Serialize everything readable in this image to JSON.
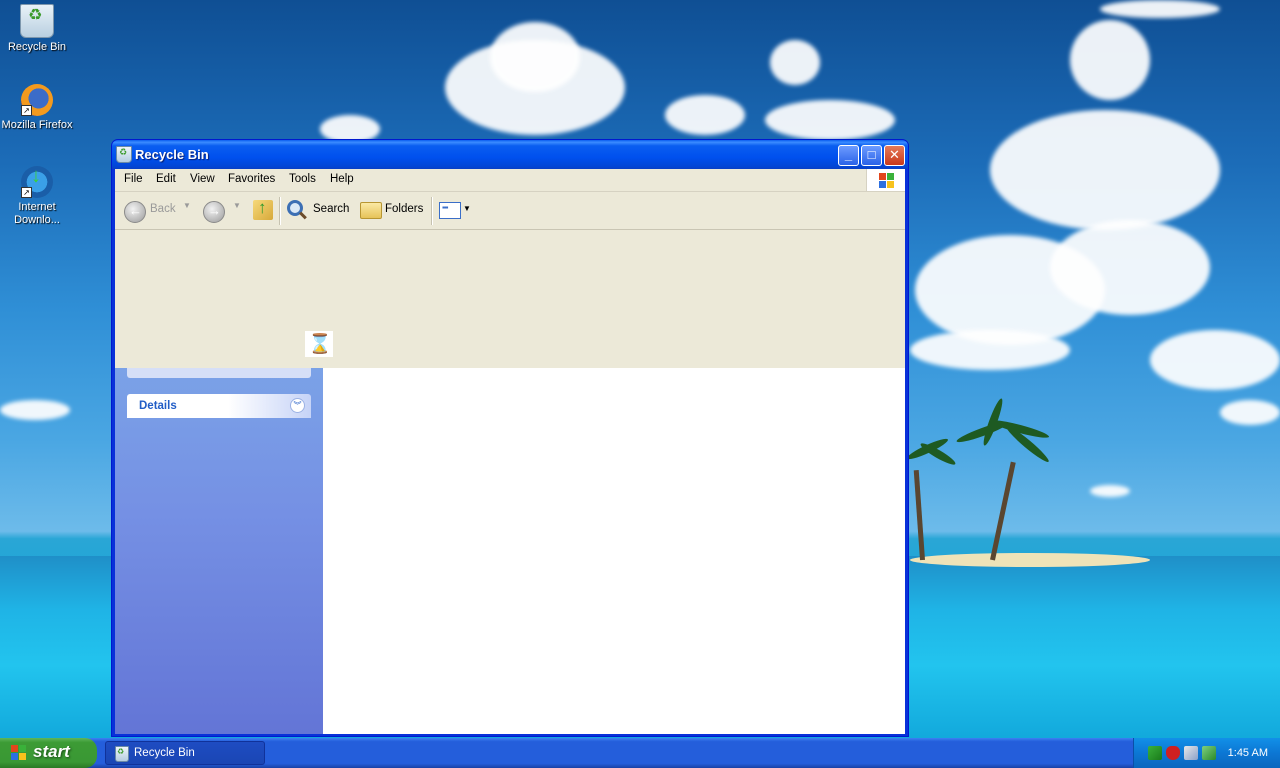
{
  "desktop": {
    "icons": [
      {
        "label": "Recycle Bin",
        "icon": "recycle-bin-icon"
      },
      {
        "label": "Mozilla Firefox",
        "icon": "firefox-icon"
      },
      {
        "label": "Internet Downlo...",
        "icon": "internet-download-manager-icon"
      }
    ]
  },
  "window": {
    "title": "Recycle Bin",
    "controls": {
      "minimize": "_",
      "maximize": "□",
      "close": "✕"
    },
    "menu": [
      "File",
      "Edit",
      "View",
      "Favorites",
      "Tools",
      "Help"
    ],
    "toolbar": {
      "back_label": "Back",
      "search_label": "Search",
      "folders_label": "Folders"
    },
    "taskpane": {
      "details_label": "Details"
    }
  },
  "taskbar": {
    "start_label": "start",
    "tasks": [
      {
        "label": "Recycle Bin"
      }
    ],
    "clock": "1:45 AM"
  },
  "colors": {
    "titlebar": "#0050ee",
    "start_button": "#3c9b35",
    "taskbar": "#245edb",
    "taskpane": "#7590e4",
    "window_chrome": "#ece9d8"
  }
}
